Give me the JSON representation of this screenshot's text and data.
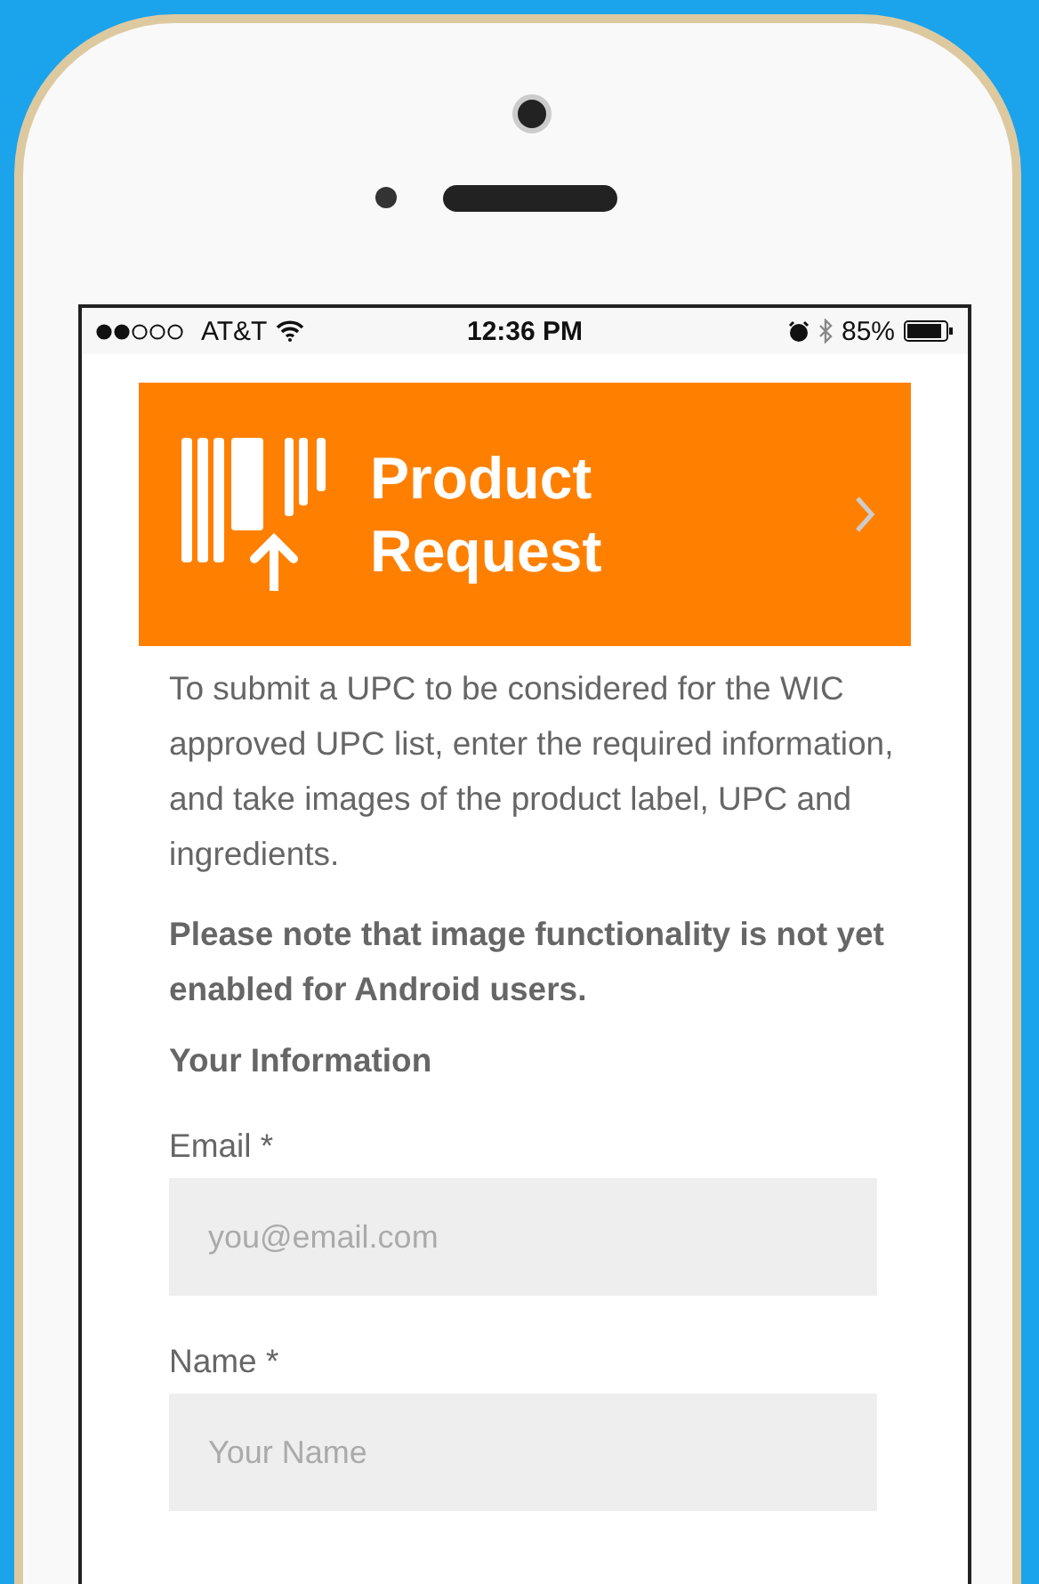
{
  "status_bar": {
    "carrier": "AT&T",
    "time": "12:36 PM",
    "battery": "85%"
  },
  "banner": {
    "title": "Product Request"
  },
  "intro": "To submit a UPC to be considered for the WIC approved UPC list, enter the required information, and take images of the product label, UPC and ingredients.",
  "note": "Please note that image functionality is not yet enabled for Android users.",
  "section_title": "Your Information",
  "fields": [
    {
      "label": "Email *",
      "placeholder": "you@email.com"
    },
    {
      "label": "Name *",
      "placeholder": "Your Name"
    }
  ]
}
